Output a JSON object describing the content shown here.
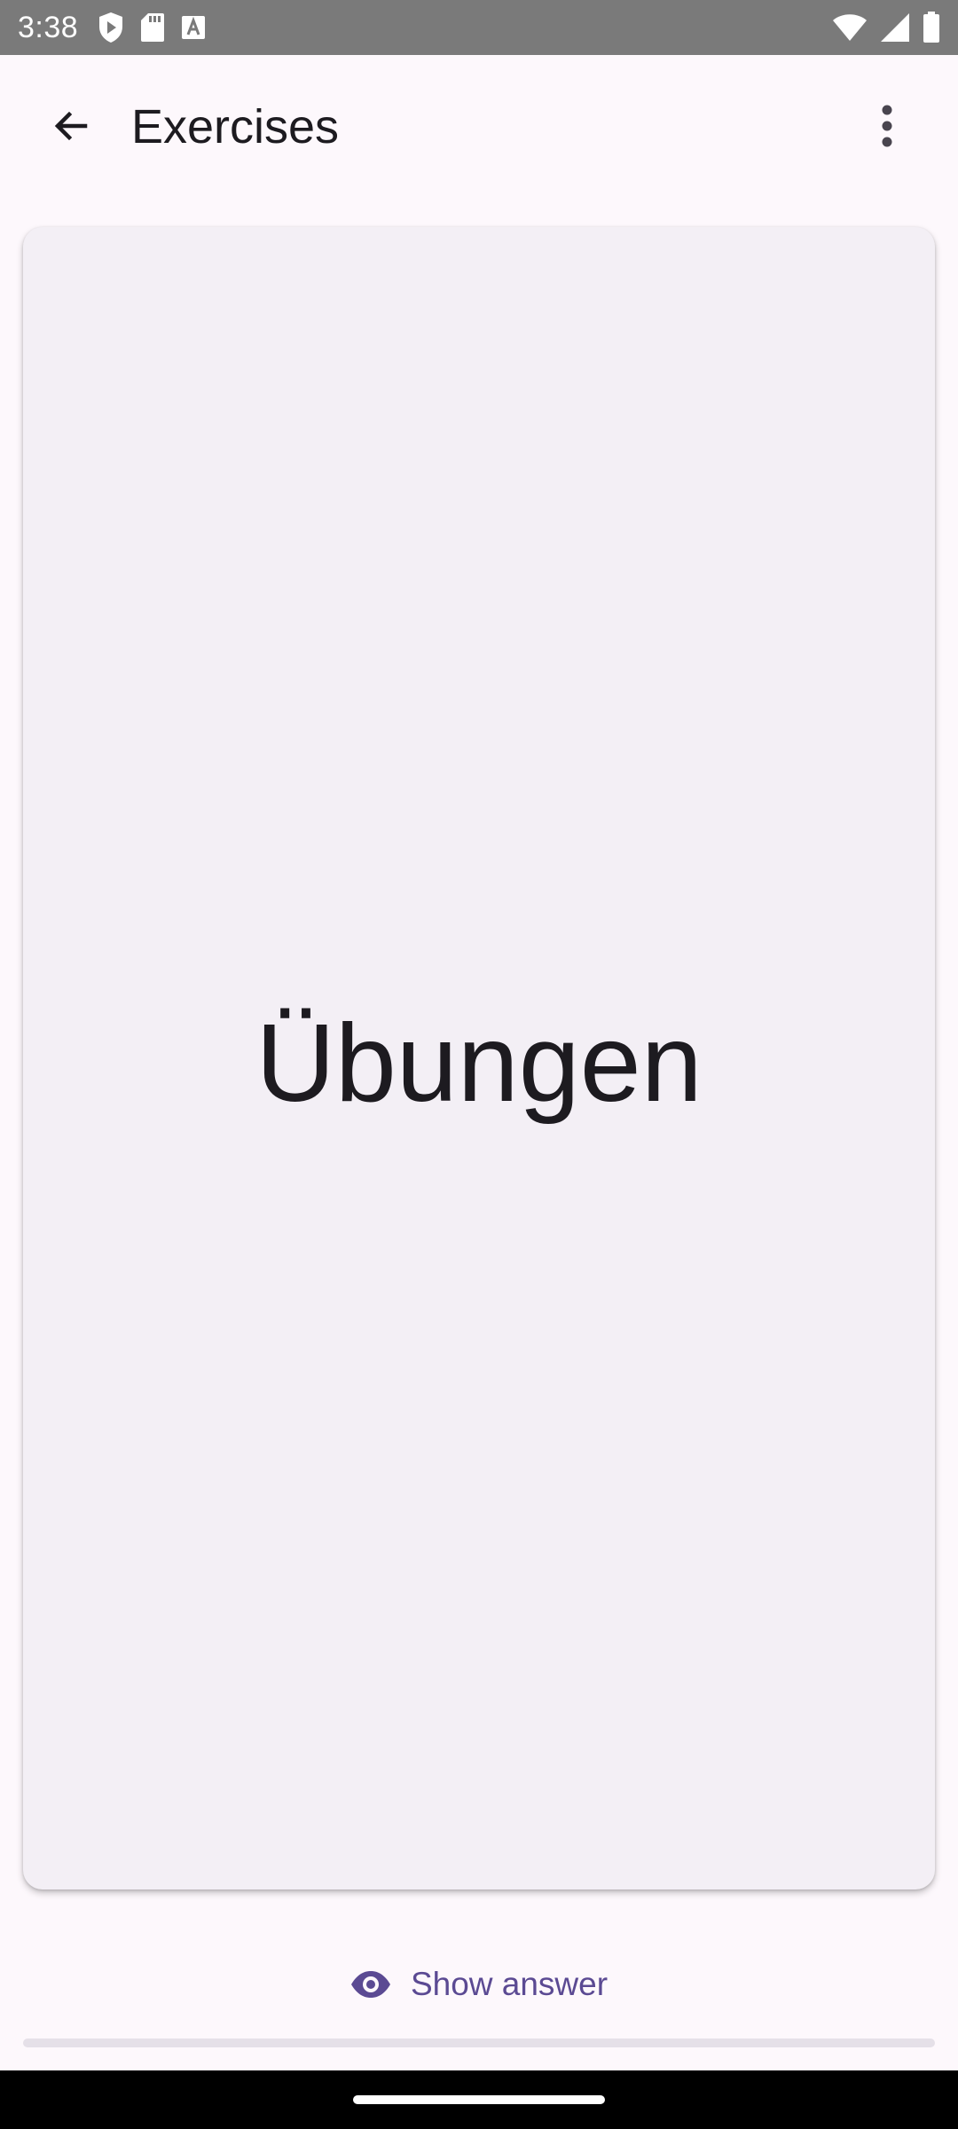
{
  "status_bar": {
    "time": "3:38",
    "left_icons": [
      "shield-play-icon",
      "sd-card-icon",
      "font-a-icon"
    ],
    "right_icons": [
      "wifi-icon",
      "signal-icon",
      "battery-icon"
    ]
  },
  "app_bar": {
    "title": "Exercises",
    "back_icon": "arrow-back-icon",
    "overflow_icon": "more-vert-icon"
  },
  "card": {
    "term": "Übungen"
  },
  "show_answer": {
    "label": "Show answer",
    "icon": "eye-icon"
  },
  "progress": {
    "fraction": 0
  },
  "colors": {
    "background": "#fdf8fc",
    "card": "#f3eff5",
    "accent": "#5b4a93",
    "status_bar": "#7a7a7a"
  }
}
